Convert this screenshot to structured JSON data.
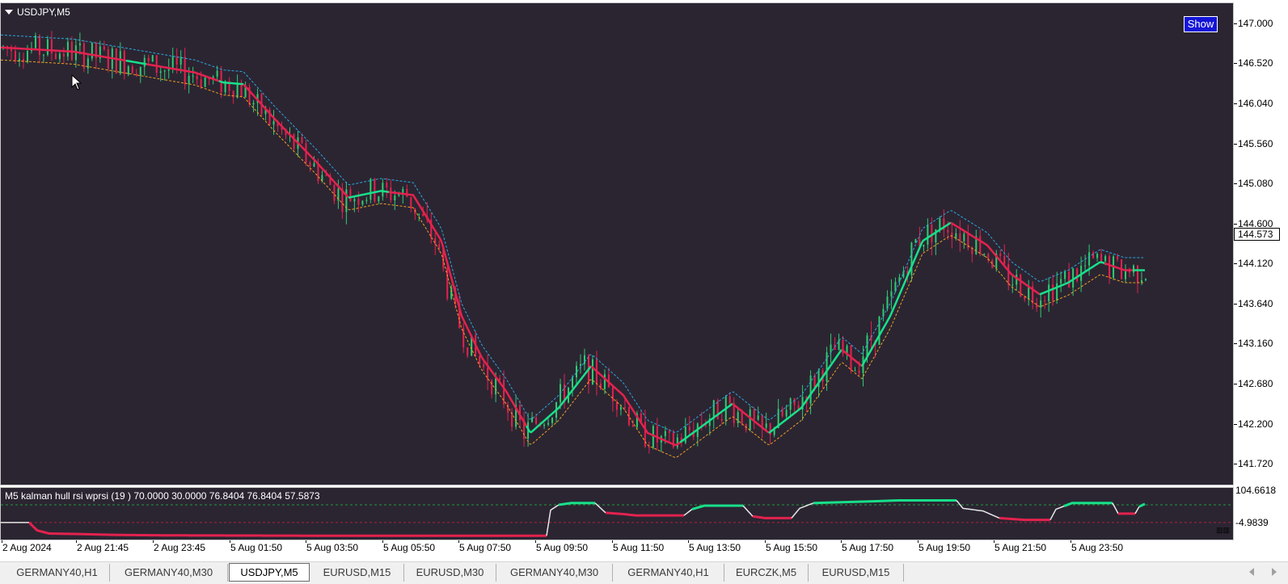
{
  "chart": {
    "symbol": "USDJPY,M5",
    "show_label": "Show",
    "current_price": "144.573",
    "price_ticks": [
      "147.000",
      "146.520",
      "146.040",
      "145.560",
      "145.080",
      "144.600",
      "144.120",
      "143.640",
      "143.160",
      "142.680",
      "142.200",
      "141.720"
    ],
    "price_range": [
      141.48,
      147.25
    ],
    "colors": {
      "background": "#2b2532",
      "bull_candle": "#2ecc71",
      "bear_candle": "#e3224e",
      "hull_up": "#18e08a",
      "hull_down": "#e3224e",
      "band_upper": "#2aa8e0",
      "band_lower": "#f0a020"
    },
    "hull_line": [
      [
        0,
        146.72
      ],
      [
        90,
        146.67
      ],
      [
        180,
        146.52
      ],
      [
        240,
        146.42
      ],
      [
        275,
        146.3
      ],
      [
        300,
        146.28
      ],
      [
        340,
        145.85
      ],
      [
        390,
        145.35
      ],
      [
        430,
        144.92
      ],
      [
        470,
        145.0
      ],
      [
        510,
        144.95
      ],
      [
        545,
        144.4
      ],
      [
        570,
        143.5
      ],
      [
        595,
        143.0
      ],
      [
        625,
        142.6
      ],
      [
        655,
        142.1
      ],
      [
        690,
        142.4
      ],
      [
        730,
        142.9
      ],
      [
        770,
        142.55
      ],
      [
        800,
        142.1
      ],
      [
        835,
        141.95
      ],
      [
        870,
        142.2
      ],
      [
        905,
        142.45
      ],
      [
        950,
        142.1
      ],
      [
        990,
        142.4
      ],
      [
        1040,
        143.1
      ],
      [
        1065,
        142.9
      ],
      [
        1100,
        143.5
      ],
      [
        1140,
        144.4
      ],
      [
        1175,
        144.62
      ],
      [
        1220,
        144.35
      ],
      [
        1250,
        144.0
      ],
      [
        1285,
        143.76
      ],
      [
        1320,
        143.9
      ],
      [
        1360,
        144.15
      ],
      [
        1390,
        144.05
      ],
      [
        1415,
        144.05
      ]
    ],
    "hull_segments": [
      {
        "from": 0,
        "to": 155,
        "dir": "down"
      },
      {
        "from": 155,
        "to": 180,
        "dir": "up"
      },
      {
        "from": 180,
        "to": 270,
        "dir": "down"
      },
      {
        "from": 270,
        "to": 300,
        "dir": "up"
      },
      {
        "from": 300,
        "to": 430,
        "dir": "down"
      },
      {
        "from": 430,
        "to": 480,
        "dir": "up"
      },
      {
        "from": 480,
        "to": 650,
        "dir": "down"
      },
      {
        "from": 650,
        "to": 730,
        "dir": "up"
      },
      {
        "from": 730,
        "to": 840,
        "dir": "down"
      },
      {
        "from": 840,
        "to": 905,
        "dir": "up"
      },
      {
        "from": 905,
        "to": 950,
        "dir": "down"
      },
      {
        "from": 950,
        "to": 1040,
        "dir": "up"
      },
      {
        "from": 1040,
        "to": 1065,
        "dir": "down"
      },
      {
        "from": 1065,
        "to": 1175,
        "dir": "up"
      },
      {
        "from": 1175,
        "to": 1285,
        "dir": "down"
      },
      {
        "from": 1285,
        "to": 1365,
        "dir": "up"
      },
      {
        "from": 1365,
        "to": 1400,
        "dir": "down"
      },
      {
        "from": 1400,
        "to": 1415,
        "dir": "up"
      }
    ],
    "band_offset": 0.15,
    "candle_count": 284,
    "candle_x_range": [
      3,
      1416
    ]
  },
  "indicator": {
    "label": "M5 kalman hull rsi  wprsi (19 ) 70.0000 30.0000 76.8404 76.8404 57.5873",
    "ticks": [
      "104.6618",
      "-4.9839"
    ],
    "level_upper": 70,
    "level_lower": 30,
    "value_range": [
      -4.9839,
      104.6618
    ],
    "line": [
      [
        0,
        30
      ],
      [
        35,
        30
      ],
      [
        45,
        12
      ],
      [
        60,
        5
      ],
      [
        95,
        4
      ],
      [
        140,
        2
      ],
      [
        200,
        1
      ],
      [
        400,
        0
      ],
      [
        675,
        0
      ],
      [
        680,
        58
      ],
      [
        690,
        70
      ],
      [
        705,
        74
      ],
      [
        735,
        74
      ],
      [
        748,
        52
      ],
      [
        770,
        49
      ],
      [
        785,
        46
      ],
      [
        845,
        46
      ],
      [
        855,
        60
      ],
      [
        870,
        68
      ],
      [
        918,
        68
      ],
      [
        930,
        44
      ],
      [
        945,
        40
      ],
      [
        978,
        40
      ],
      [
        988,
        62
      ],
      [
        1005,
        74
      ],
      [
        1080,
        78
      ],
      [
        1110,
        80
      ],
      [
        1182,
        80
      ],
      [
        1190,
        62
      ],
      [
        1215,
        56
      ],
      [
        1235,
        40
      ],
      [
        1265,
        36
      ],
      [
        1298,
        36
      ],
      [
        1305,
        60
      ],
      [
        1325,
        74
      ],
      [
        1375,
        74
      ],
      [
        1382,
        50
      ],
      [
        1403,
        50
      ],
      [
        1408,
        66
      ],
      [
        1415,
        72
      ]
    ],
    "line_segments": [
      {
        "from": 0,
        "to": 35,
        "state": "neutral"
      },
      {
        "from": 35,
        "to": 675,
        "state": "down"
      },
      {
        "from": 675,
        "to": 690,
        "state": "neutral"
      },
      {
        "from": 690,
        "to": 735,
        "state": "up"
      },
      {
        "from": 735,
        "to": 748,
        "state": "neutral"
      },
      {
        "from": 748,
        "to": 845,
        "state": "down"
      },
      {
        "from": 845,
        "to": 855,
        "state": "neutral"
      },
      {
        "from": 855,
        "to": 918,
        "state": "up"
      },
      {
        "from": 918,
        "to": 930,
        "state": "neutral"
      },
      {
        "from": 930,
        "to": 978,
        "state": "down"
      },
      {
        "from": 978,
        "to": 1005,
        "state": "neutral"
      },
      {
        "from": 1005,
        "to": 1182,
        "state": "up"
      },
      {
        "from": 1182,
        "to": 1235,
        "state": "neutral"
      },
      {
        "from": 1235,
        "to": 1298,
        "state": "down"
      },
      {
        "from": 1298,
        "to": 1315,
        "state": "neutral"
      },
      {
        "from": 1315,
        "to": 1375,
        "state": "up"
      },
      {
        "from": 1375,
        "to": 1382,
        "state": "neutral"
      },
      {
        "from": 1382,
        "to": 1403,
        "state": "down"
      },
      {
        "from": 1403,
        "to": 1408,
        "state": "neutral"
      },
      {
        "from": 1408,
        "to": 1415,
        "state": "up"
      }
    ],
    "colors": {
      "up": "#18e08a",
      "down": "#e3224e",
      "neutral": "#e8e8e8",
      "level_up": "#1e9a3a",
      "level_down": "#b0203a"
    }
  },
  "time_axis": {
    "labels": [
      "2 Aug 2024",
      "2 Aug 21:45",
      "2 Aug 23:45",
      "5 Aug 01:50",
      "5 Aug 03:50",
      "5 Aug 05:50",
      "5 Aug 07:50",
      "5 Aug 09:50",
      "5 Aug 11:50",
      "5 Aug 13:50",
      "5 Aug 15:50",
      "5 Aug 17:50",
      "5 Aug 19:50",
      "5 Aug 21:50",
      "5 Aug 23:50"
    ]
  },
  "tabs": [
    {
      "label": "GERMANY40,H1",
      "active": false
    },
    {
      "label": "GERMANY40,M30",
      "active": false
    },
    {
      "label": "USDJPY,M5",
      "active": true
    },
    {
      "label": "EURUSD,M15",
      "active": false
    },
    {
      "label": "EURUSD,M30",
      "active": false
    },
    {
      "label": "GERMANY40,M30",
      "active": false
    },
    {
      "label": "GERMANY40,H1",
      "active": false
    },
    {
      "label": "EURCZK,M5",
      "active": false
    },
    {
      "label": "EURUSD,M15",
      "active": false
    }
  ],
  "icons": {
    "cursor": "arrow-cursor-icon",
    "scroll_left": "triangle-left-icon",
    "scroll_right": "triangle-right-icon"
  }
}
